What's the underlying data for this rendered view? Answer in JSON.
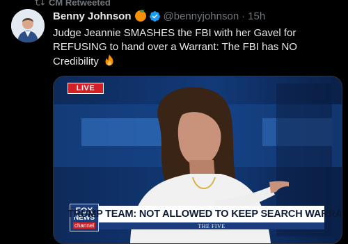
{
  "retweet": {
    "label": "CM Retweeted"
  },
  "tweet": {
    "author_name": "Benny Johnson",
    "handle": "@bennyjohnson",
    "separator": "·",
    "time": "15h",
    "text": "Judge Jeannie SMASHES the FBI with her Gavel for REFUSING to hand over a Warrant: The FBI has NO Credibility",
    "name_emoji": "orange-emoji",
    "text_emoji": "fire-emoji"
  },
  "media": {
    "live_badge": "LIVE",
    "chyron_headline": "TRUMP TEAM: NOT ALLOWED TO KEEP SEARCH WARRANT",
    "show_name": "THE FIVE",
    "network_logo": {
      "line1": "FOX",
      "line2": "NEWS",
      "line3": "channel"
    }
  },
  "colors": {
    "background": "#000000",
    "text_primary": "#e7e9ea",
    "text_secondary": "#71767b",
    "verified_badge": "#1d9bf0",
    "live_red": "#d31f26",
    "fox_blue": "#1b3b79"
  }
}
